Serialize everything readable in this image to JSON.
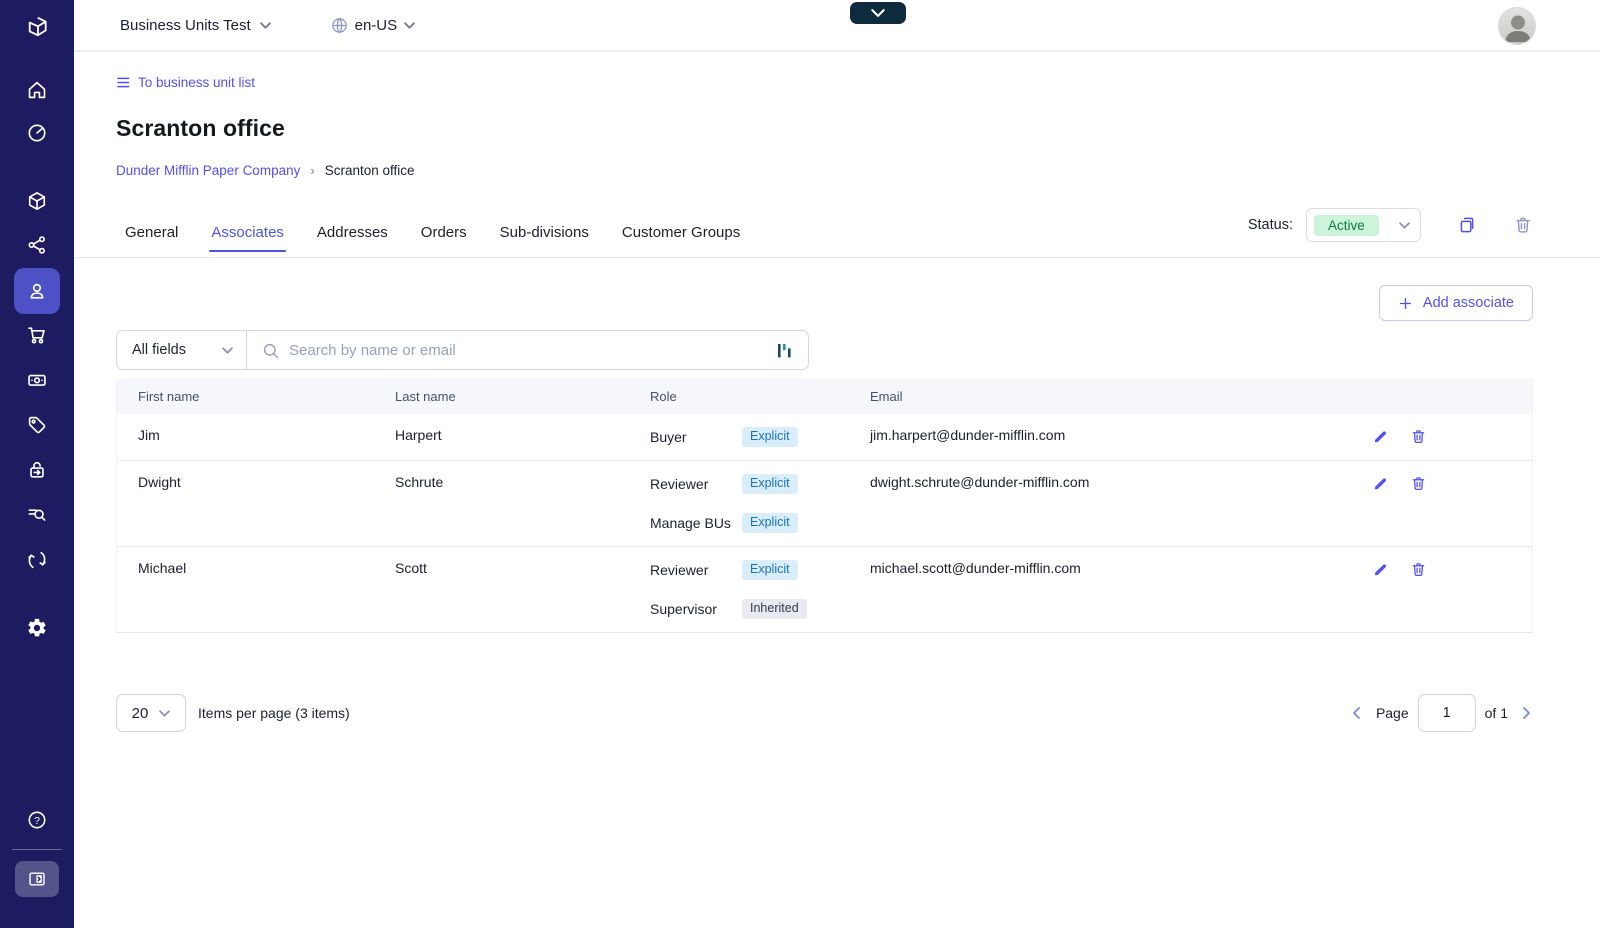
{
  "colors": {
    "accent": "#544ff1",
    "sidebar_bg": "#1d1c60",
    "sidebar_active_bg": "#4d51c6",
    "tab_active": "#4f53e8",
    "status_active_bg": "#cbf4da",
    "status_active_text": "#0d7a3f",
    "badge_explicit_bg": "#d9edfb",
    "badge_explicit_text": "#1873b9",
    "badge_inherited_bg": "#e9ebf1",
    "badge_inherited_text": "#303850",
    "dark_toggle_bg": "#0e2b3e"
  },
  "topbar": {
    "project_name": "Business Units Test",
    "locale": "en-US"
  },
  "sidebar": {
    "icons": [
      "home",
      "dashboard",
      "products",
      "categories",
      "customers",
      "orders",
      "payments",
      "discounts",
      "checkout",
      "audit-log",
      "operations",
      "settings"
    ],
    "active_icon": "customers",
    "footer_icons": [
      "help",
      "collapse-menu"
    ]
  },
  "page": {
    "back_link": "To business unit list",
    "title": "Scranton office",
    "breadcrumb_parent": "Dunder Mifflin Paper Company",
    "breadcrumb_separator": "›",
    "breadcrumb_current": "Scranton office",
    "tabs": [
      "General",
      "Associates",
      "Addresses",
      "Orders",
      "Sub-divisions",
      "Customer Groups"
    ],
    "active_tab": "Associates",
    "status_label": "Status:",
    "status_value": "Active"
  },
  "associates": {
    "add_button": "Add associate",
    "filter_value": "All fields",
    "search_placeholder": "Search by name or email",
    "columns": [
      "First name",
      "Last name",
      "Role",
      "Email"
    ],
    "rows": [
      {
        "first_name": "Jim",
        "last_name": "Harpert",
        "roles": [
          {
            "name": "Buyer",
            "badge": "Explicit",
            "type": "explicit"
          }
        ],
        "email": "jim.harpert@dunder-mifflin.com"
      },
      {
        "first_name": "Dwight",
        "last_name": "Schrute",
        "roles": [
          {
            "name": "Reviewer",
            "badge": "Explicit",
            "type": "explicit"
          },
          {
            "name": "Manage BUs",
            "badge": "Explicit",
            "type": "explicit"
          }
        ],
        "email": "dwight.schrute@dunder-mifflin.com"
      },
      {
        "first_name": "Michael",
        "last_name": "Scott",
        "roles": [
          {
            "name": "Reviewer",
            "badge": "Explicit",
            "type": "explicit"
          },
          {
            "name": "Supervisor",
            "badge": "Inherited",
            "type": "inherited"
          }
        ],
        "email": "michael.scott@dunder-mifflin.com"
      }
    ]
  },
  "pagination": {
    "per_page": "20",
    "items_label": "Items per page (3 items)",
    "page_label": "Page",
    "page_value": "1",
    "of_label": "of 1"
  }
}
